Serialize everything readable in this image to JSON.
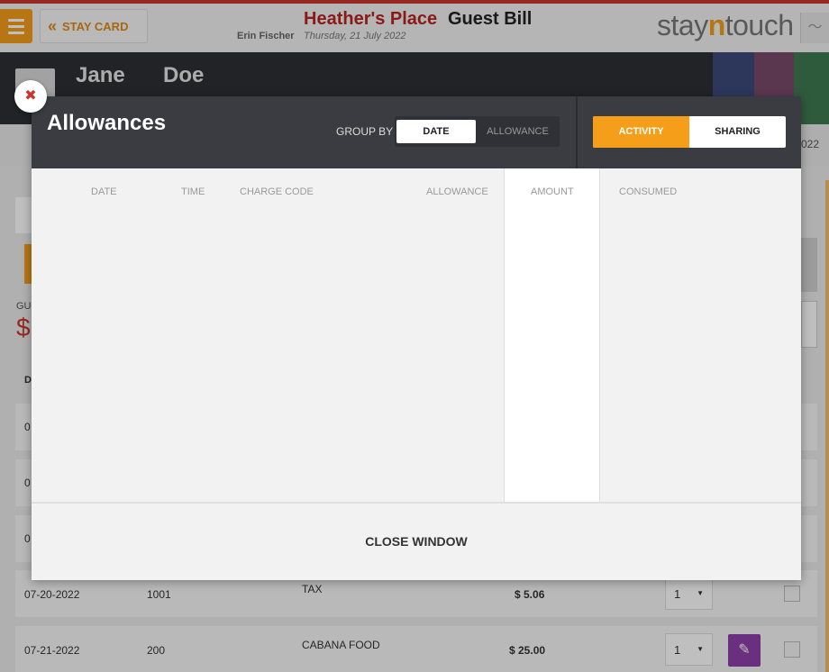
{
  "header": {
    "stay_card_label": "STAY CARD",
    "hotel_name": "Heather's Place",
    "page_title": "Guest Bill",
    "staff_name": "Erin Fischer",
    "date": "Thursday, 21 July 2022",
    "brand": {
      "pre": "stay",
      "accent": "n",
      "post": "touch"
    }
  },
  "guest": {
    "first_name": "Jane",
    "last_name": "Doe"
  },
  "background": {
    "year_fragment": "022",
    "gu_fragment": "GU",
    "dollar_fragment": "$",
    "d_fragment": "D",
    "rows": [
      {
        "date": "07-20-2022",
        "room": "1001",
        "code": "TAX",
        "amount": "$ 5.06",
        "qty": "1"
      },
      {
        "date": "07-21-2022",
        "room": "200",
        "code": "CABANA FOOD",
        "amount": "$ 25.00",
        "qty": "1"
      }
    ],
    "row_fragments": [
      "0",
      "0",
      "0"
    ]
  },
  "modal": {
    "title": "Allowances",
    "group_by_label": "GROUP BY",
    "group_options": [
      "DATE",
      "ALLOWANCE"
    ],
    "group_selected": "DATE",
    "view_toggle": [
      "ACTIVITY",
      "SHARING"
    ],
    "view_selected": "ACTIVITY",
    "columns": [
      "DATE",
      "TIME",
      "CHARGE CODE",
      "ALLOWANCE",
      "AMOUNT",
      "CONSUMED"
    ],
    "close_label": "CLOSE WINDOW"
  },
  "colors": {
    "accent": "#f59e1a",
    "brand_red": "#b8231c",
    "header_dark": "#3a3c41",
    "edit_purple": "#8e3fa8"
  }
}
